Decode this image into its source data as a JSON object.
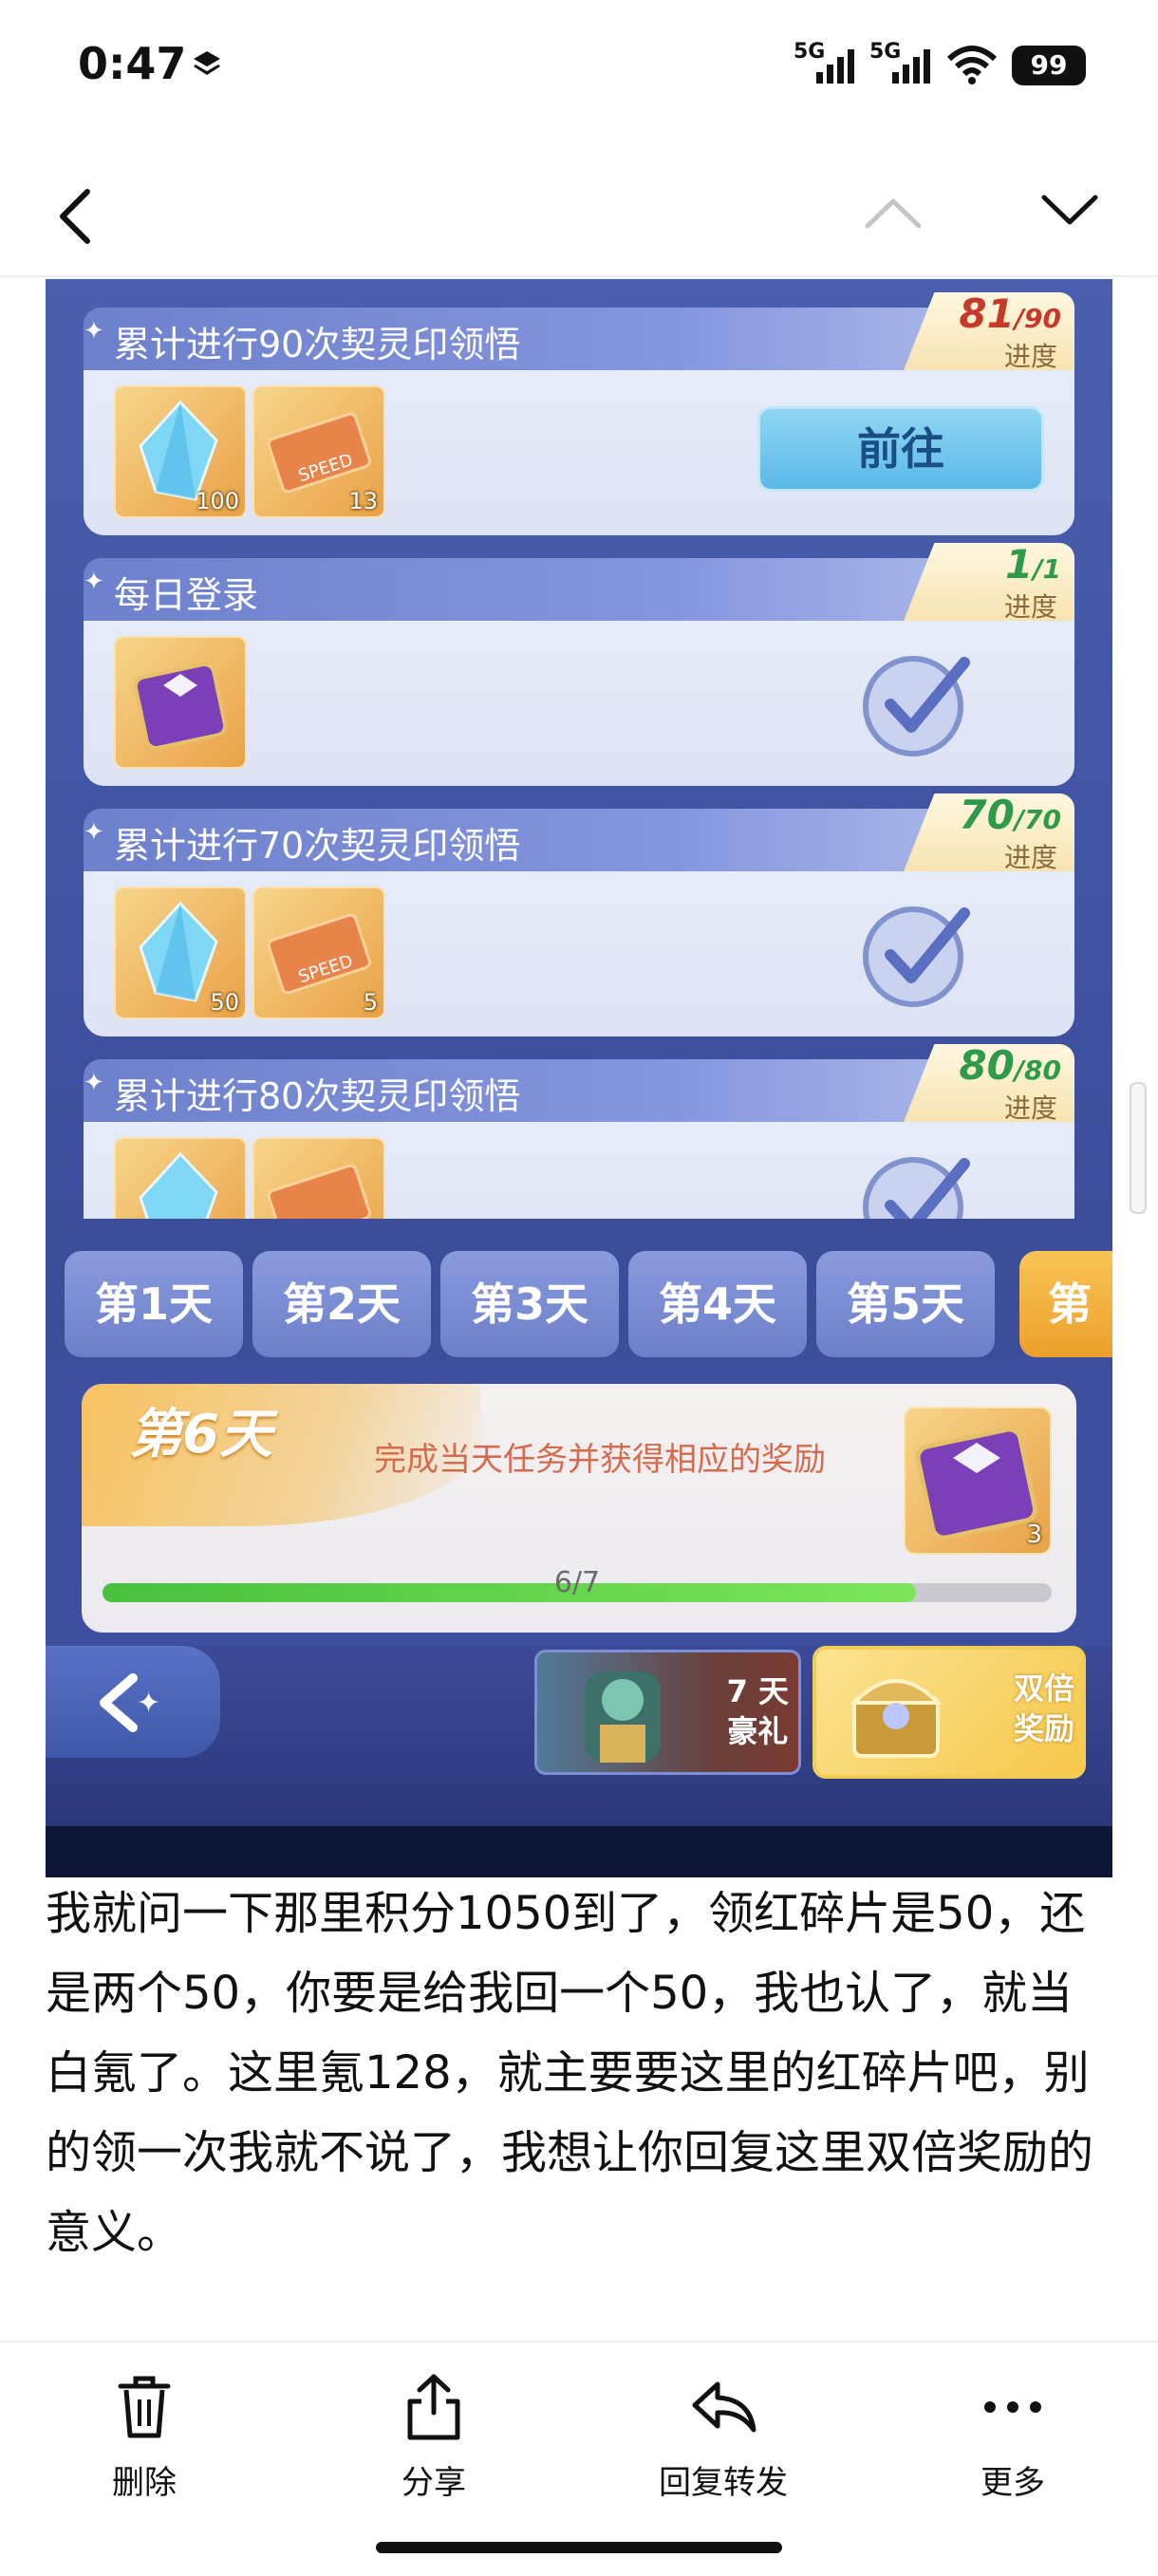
{
  "status": {
    "time": "0:47",
    "net1": "5G",
    "net2": "5G",
    "battery": "99"
  },
  "nav": {
    "back_icon": "chevron-left-icon",
    "up_icon": "chevron-up-icon",
    "down_icon": "chevron-down-icon"
  },
  "tasks": [
    {
      "title": "累计进行90次契灵印领悟",
      "progress": "81",
      "total": "/90",
      "progress_label": "进度",
      "items": [
        {
          "icon": "crystal-icon",
          "qty": "100"
        },
        {
          "icon": "speed-ticket-icon",
          "qty": "13"
        }
      ],
      "action": "前往",
      "done": false
    },
    {
      "title": "每日登录",
      "progress": "1",
      "total": "/1",
      "progress_label": "进度",
      "items": [
        {
          "icon": "purple-chest-icon",
          "qty": ""
        }
      ],
      "done": true
    },
    {
      "title": "累计进行70次契灵印领悟",
      "progress": "70",
      "total": "/70",
      "progress_label": "进度",
      "items": [
        {
          "icon": "crystal-icon",
          "qty": "50"
        },
        {
          "icon": "speed-ticket-icon",
          "qty": "5"
        }
      ],
      "done": true
    },
    {
      "title": "累计进行80次契灵印领悟",
      "progress": "80",
      "total": "/80",
      "progress_label": "进度",
      "items": [
        {
          "icon": "crystal-icon",
          "qty": ""
        },
        {
          "icon": "speed-ticket-icon",
          "qty": ""
        }
      ],
      "done": true
    }
  ],
  "day_tabs": [
    "第1天",
    "第2天",
    "第3天",
    "第4天",
    "第5天",
    "第"
  ],
  "day_card": {
    "day": "第6天",
    "description": "完成当天任务并获得相应的奖励",
    "reward_qty": "3",
    "progress_text": "6/7",
    "progress_fraction": 0.857
  },
  "bottom": {
    "gift_line1": "7 天",
    "gift_line2": "豪礼",
    "double_line1": "双倍",
    "double_line2": "奖励"
  },
  "post_text": "我就问一下那里积分1050到了，领红碎片是50，还是两个50，你要是给我回一个50，我也认了，就当白氪了。这里氪128，就主要要这里的红碎片吧，别的领一次我就不说了，我想让你回复这里双倍奖励的意义。",
  "toolbar": [
    {
      "label": "删除",
      "icon": "trash-icon"
    },
    {
      "label": "分享",
      "icon": "share-icon"
    },
    {
      "label": "回复转发",
      "icon": "reply-icon"
    },
    {
      "label": "更多",
      "icon": "more-icon"
    }
  ],
  "colors": {
    "game_bg": "#3d4f9e",
    "accent_gold": "#f6c74a",
    "progress_green": "#49c03f"
  }
}
